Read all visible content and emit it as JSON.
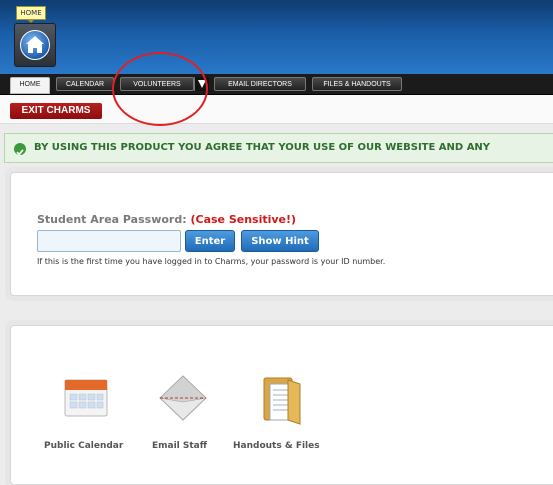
{
  "header": {
    "home_tooltip": "HOME"
  },
  "nav": {
    "tabs": [
      {
        "label": "HOME"
      },
      {
        "label": "CALENDAR"
      },
      {
        "label": "VOLUNTEERS"
      },
      {
        "label": "EMAIL DIRECTORS"
      },
      {
        "label": "FILES & HANDOUTS"
      }
    ]
  },
  "subbar": {
    "exit_label": "EXIT CHARMS"
  },
  "notice": {
    "text": "BY USING THIS PRODUCT YOU AGREE THAT YOUR USE OF OUR WEBSITE AND ANY"
  },
  "login": {
    "label": "Student Area Password:",
    "case_note": "(Case Sensitive!)",
    "input_value": "",
    "enter_label": "Enter",
    "hint_label": "Show Hint",
    "note": "If this is the first time you have logged in to Charms, your password is your ID number."
  },
  "apps": [
    {
      "label": "Public Calendar",
      "icon": "calendar-icon"
    },
    {
      "label": "Email Staff",
      "icon": "envelope-icon"
    },
    {
      "label": "Handouts & Files",
      "icon": "folder-icon"
    }
  ],
  "colors": {
    "banner": "#1a5ea8",
    "exit": "#a41616",
    "accent_red": "#d01818",
    "notice_green": "#3c9a3a",
    "button_blue": "#2a7bc8"
  }
}
